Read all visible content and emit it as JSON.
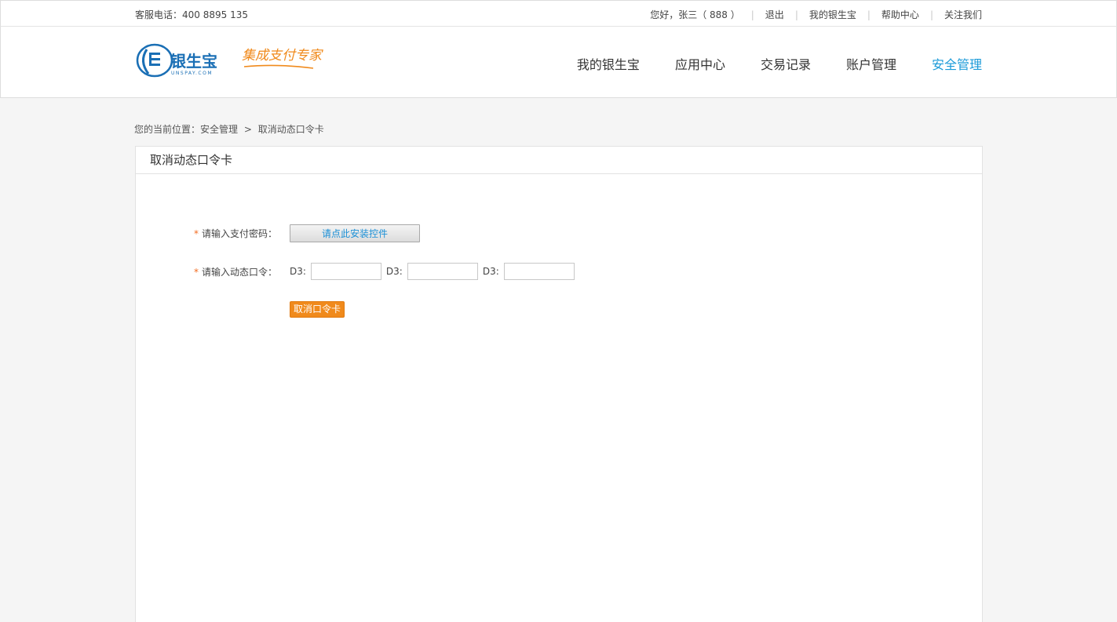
{
  "topbar": {
    "hotline": "客服电话：400 8895 135",
    "greeting": "您好，张三（ 888 ）",
    "links": [
      "退出",
      "我的银生宝",
      "帮助中心",
      "关注我们"
    ]
  },
  "header": {
    "logo_text": "银生宝",
    "logo_sub": "UNSPAY.COM",
    "slogan": "集成支付专家",
    "nav": [
      "我的银生宝",
      "应用中心",
      "交易记录",
      "账户管理",
      "安全管理"
    ],
    "active_nav": "安全管理"
  },
  "breadcrumb": {
    "prefix": "您的当前位置：安全管理",
    "arrow": ">",
    "current": "取消动态口令卡"
  },
  "panel": {
    "title": "取消动态口令卡",
    "pay_password_label": "请输入支付密码：",
    "install_button": "请点此安装控件",
    "otp_label": "请输入动态口令：",
    "otp_fields": [
      {
        "prefix": "D3:",
        "value": ""
      },
      {
        "prefix": "D3:",
        "value": ""
      },
      {
        "prefix": "D3:",
        "value": ""
      }
    ],
    "required_mark": "*",
    "cancel_button": "取消口令卡"
  },
  "colors": {
    "accent": "#1a9ad8",
    "orange": "#f08a1c",
    "required": "#f26c22"
  }
}
